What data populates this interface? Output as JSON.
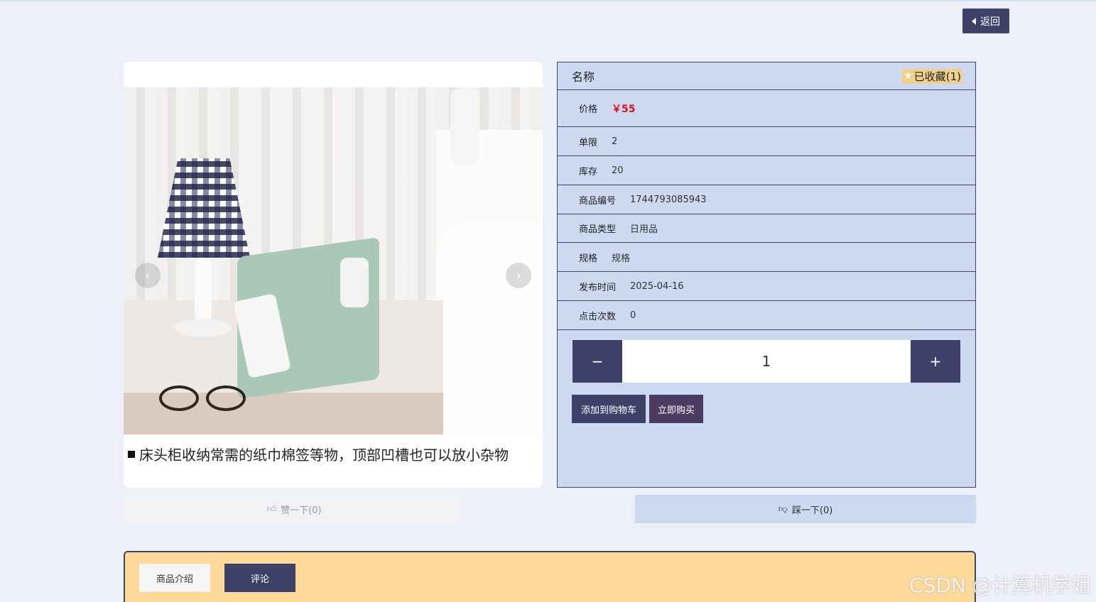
{
  "header": {
    "back_label": "返回"
  },
  "product": {
    "caption": "床头柜收纳常需的纸巾棉签等物，顶部凹槽也可以放小杂物",
    "name_label": "名称",
    "favorite_label": "已收藏(1)",
    "fields": [
      {
        "label": "价格",
        "value": "￥55"
      },
      {
        "label": "单限",
        "value": "2"
      },
      {
        "label": "库存",
        "value": "20"
      },
      {
        "label": "商品编号",
        "value": "1744793085943"
      },
      {
        "label": "商品类型",
        "value": "日用品"
      },
      {
        "label": "规格",
        "value": "规格"
      },
      {
        "label": "发布时间",
        "value": "2025-04-16"
      },
      {
        "label": "点击次数",
        "value": "0"
      }
    ],
    "quantity": "1",
    "minus_symbol": "−",
    "plus_symbol": "+",
    "add_to_cart_label": "添加到购物车",
    "buy_now_label": "立即购买"
  },
  "votes": {
    "like_label": "赞一下(0)",
    "dislike_label": "踩一下(0)"
  },
  "tabs": {
    "intro_label": "商品介绍",
    "comment_label": "评论"
  },
  "watermark": "CSDN @计算机学姐",
  "colors": {
    "accent": "#3f4268",
    "panel": "#cdd9f0",
    "price": "#d81020",
    "tab_bar": "#ffd99a"
  }
}
